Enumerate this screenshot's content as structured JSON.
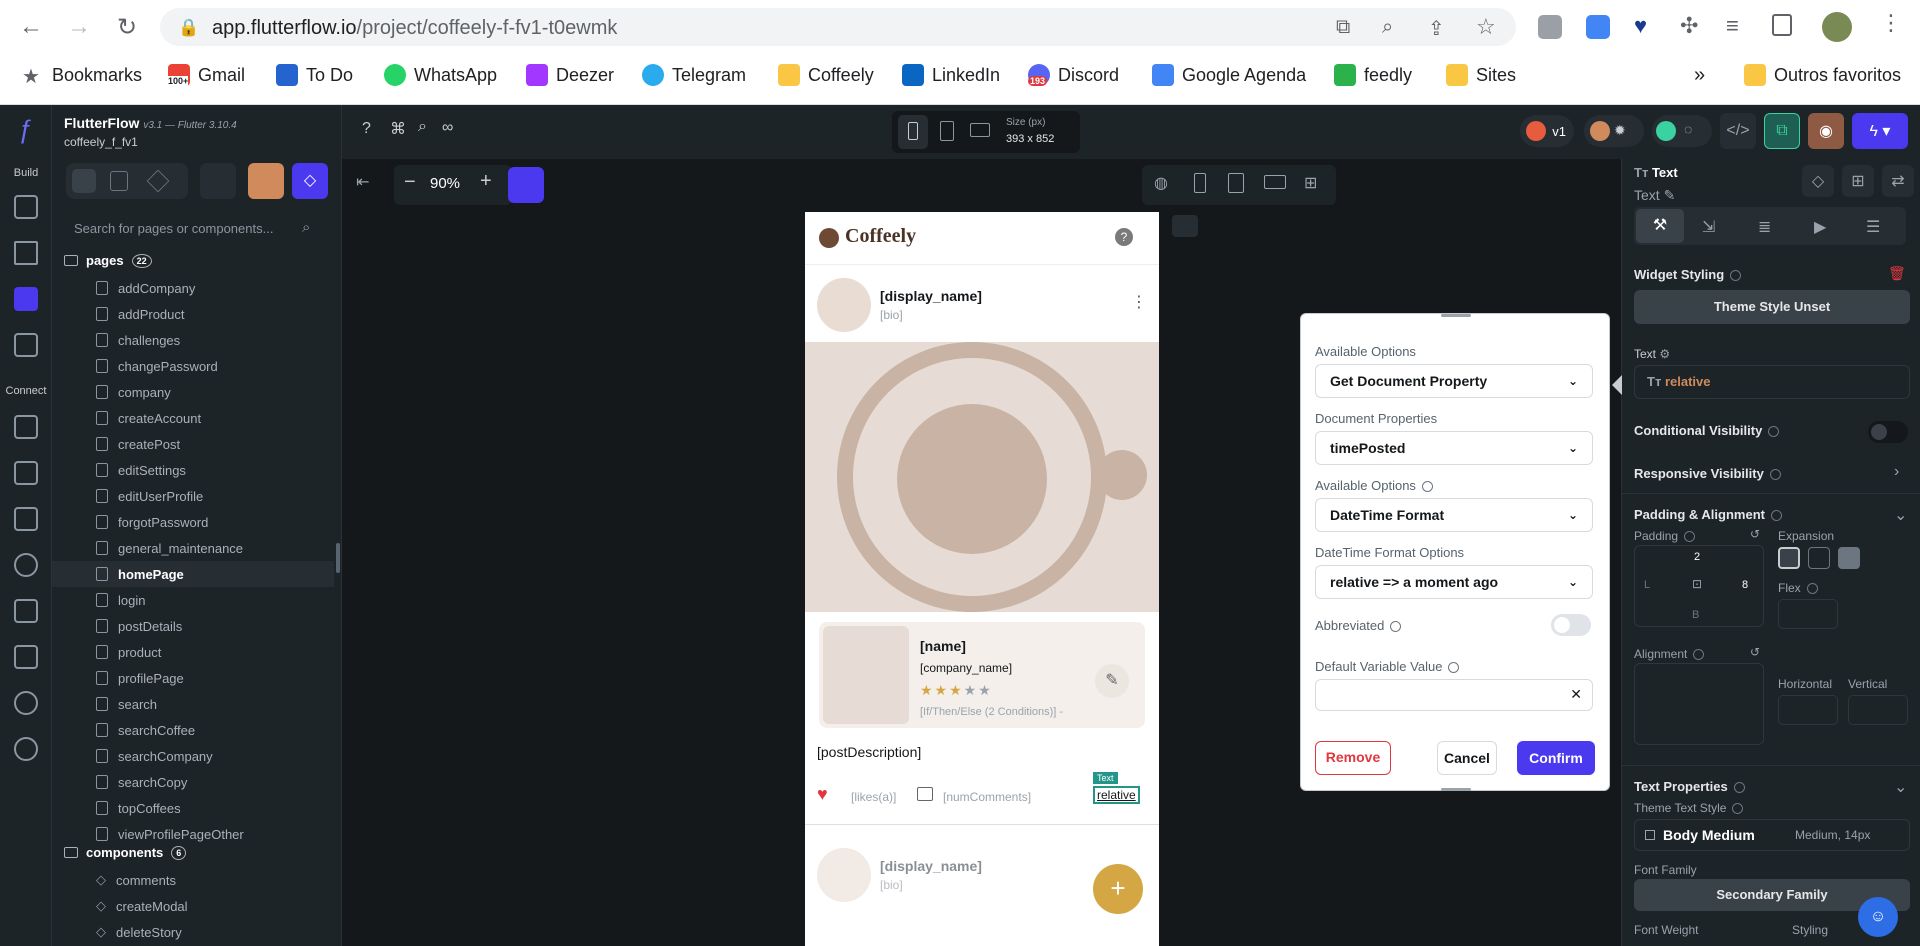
{
  "browser": {
    "url_host": "app.flutterflow.io",
    "url_path": "/project/coffeely-f-fv1-t0ewmk",
    "bookmarks": [
      {
        "label": "Bookmarks",
        "color": "#5f6368"
      },
      {
        "label": "Gmail",
        "color": "#ea4335"
      },
      {
        "label": "To Do",
        "color": "#2564cf"
      },
      {
        "label": "WhatsApp",
        "color": "#25d366"
      },
      {
        "label": "Deezer",
        "color": "#a238ff"
      },
      {
        "label": "Telegram",
        "color": "#2aabee"
      },
      {
        "label": "Coffeely",
        "color": "#f9c744"
      },
      {
        "label": "LinkedIn",
        "color": "#0a66c2"
      },
      {
        "label": "Discord",
        "color": "#5865f2"
      },
      {
        "label": "Google Agenda",
        "color": "#4285f4"
      },
      {
        "label": "feedly",
        "color": "#2bb24c"
      },
      {
        "label": "Sites",
        "color": "#f9c744"
      }
    ],
    "gmail_badge": "100+",
    "discord_badge": "193",
    "more": "»",
    "other_favorites": "Outros favoritos"
  },
  "app": {
    "brand": "FlutterFlow",
    "version": "v3.1 — Flutter 3.10.4",
    "project": "coffeely_f_fv1",
    "rail": {
      "build": "Build",
      "connect": "Connect"
    },
    "search_placeholder": "Search for pages or components...",
    "pages_label": "pages",
    "pages_count": "22",
    "pages": [
      "addCompany",
      "addProduct",
      "challenges",
      "changePassword",
      "company",
      "createAccount",
      "createPost",
      "editSettings",
      "editUserProfile",
      "forgotPassword",
      "general_maintenance",
      "homePage",
      "login",
      "postDetails",
      "product",
      "profilePage",
      "search",
      "searchCoffee",
      "searchCompany",
      "searchCopy",
      "topCoffees",
      "viewProfilePageOther"
    ],
    "selected_page": "homePage",
    "components_label": "components",
    "components_count": "6",
    "components": [
      "comments",
      "createModal",
      "deleteStory"
    ],
    "zoom": "90%",
    "size_label": "Size (px)",
    "size_value": "393 x 852",
    "version_badge": "v1"
  },
  "phone": {
    "app_title": "Coffeely",
    "display_name": "[display_name]",
    "bio": "[bio]",
    "name": "[name]",
    "company_name": "[company_name]",
    "rating": 3,
    "rating_max": 5,
    "condition": "[If/Then/Else (2 Conditions)] -",
    "description": "[postDescription]",
    "likes": "[likes(a)]",
    "comments": "[numComments]",
    "text_tag": "Text",
    "relative": "relative",
    "display_name2": "[display_name]",
    "bio2": "[bio]",
    "fab": "+"
  },
  "popup": {
    "label1": "Available Options",
    "value1": "Get Document Property",
    "label2": "Document Properties",
    "value2": "timePosted",
    "label3": "Available Options",
    "value3": "DateTime Format",
    "label4": "DateTime Format Options",
    "value4": "relative => a moment ago",
    "abbrev": "Abbreviated",
    "default_label": "Default Variable Value",
    "default_value": "",
    "remove": "Remove",
    "cancel": "Cancel",
    "confirm": "Confirm"
  },
  "props": {
    "widget_type": "Text",
    "widget_name": "Text",
    "widget_styling": "Widget Styling",
    "theme_unset": "Theme Style Unset",
    "text_label": "Text",
    "text_value": "relative",
    "cond_vis": "Conditional Visibility",
    "resp_vis": "Responsive Visibility",
    "pad_align": "Padding & Alignment",
    "padding": "Padding",
    "expansion": "Expansion",
    "pad_top": "2",
    "pad_left": "L",
    "pad_right": "8",
    "pad_bottom": "B",
    "flex": "Flex",
    "alignment": "Alignment",
    "horizontal": "Horizontal",
    "vertical": "Vertical",
    "text_props": "Text Properties",
    "theme_text_style": "Theme Text Style",
    "body_medium": "Body Medium",
    "body_medium_meta": "Medium, 14px",
    "font_family": "Font Family",
    "secondary_family": "Secondary Family",
    "font_weight": "Font Weight",
    "styling": "Styling"
  }
}
